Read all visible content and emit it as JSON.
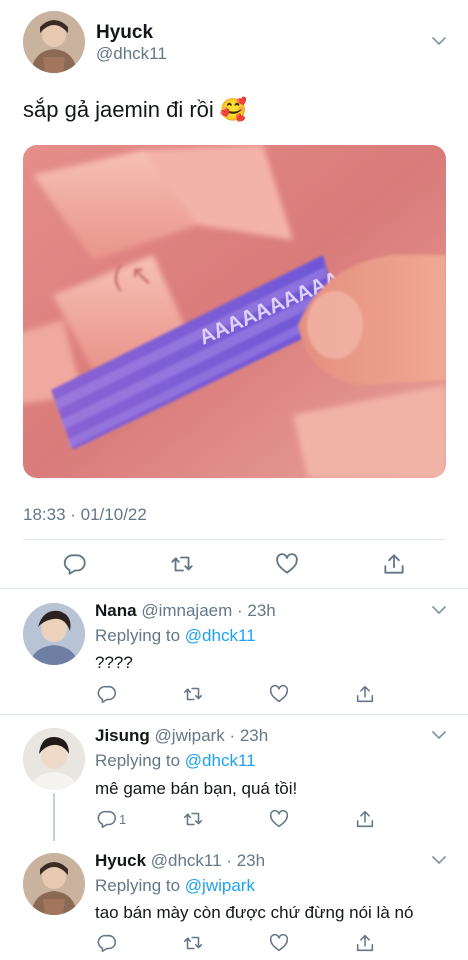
{
  "main_tweet": {
    "display_name": "Hyuck",
    "handle": "@dhck11",
    "text": "sắp gả jaemin đi rồi 🥰",
    "timestamp": "18:33 · 01/10/22",
    "media_text": "AAAAAAAAAA"
  },
  "replies": [
    {
      "display_name": "Nana",
      "handle": "@imnajaem",
      "time": "· 23h",
      "replying_prefix": "Replying to ",
      "replying_to": "@dhck11",
      "text": "????",
      "reply_count": ""
    },
    {
      "display_name": "Jisung",
      "handle": "@jwipark",
      "time": "· 23h",
      "replying_prefix": "Replying to ",
      "replying_to": "@dhck11",
      "text": "mê game bán bạn, quá tồi!",
      "reply_count": "1"
    },
    {
      "display_name": "Hyuck",
      "handle": "@dhck11",
      "time": "· 23h",
      "replying_prefix": "Replying to ",
      "replying_to": "@jwipark",
      "text": "tao bán mày còn được chứ đừng nói là nó",
      "reply_count": ""
    }
  ],
  "icons": {
    "reply": "reply-icon",
    "retweet": "retweet-icon",
    "like": "heart-icon",
    "share": "share-icon",
    "more": "chevron-down-icon"
  },
  "colors": {
    "link": "#1da1f2",
    "secondary": "#657786",
    "divider": "#e1e8ed",
    "media_key": "#f2a7a0",
    "media_keys_highlight": "#7b5bd6"
  }
}
